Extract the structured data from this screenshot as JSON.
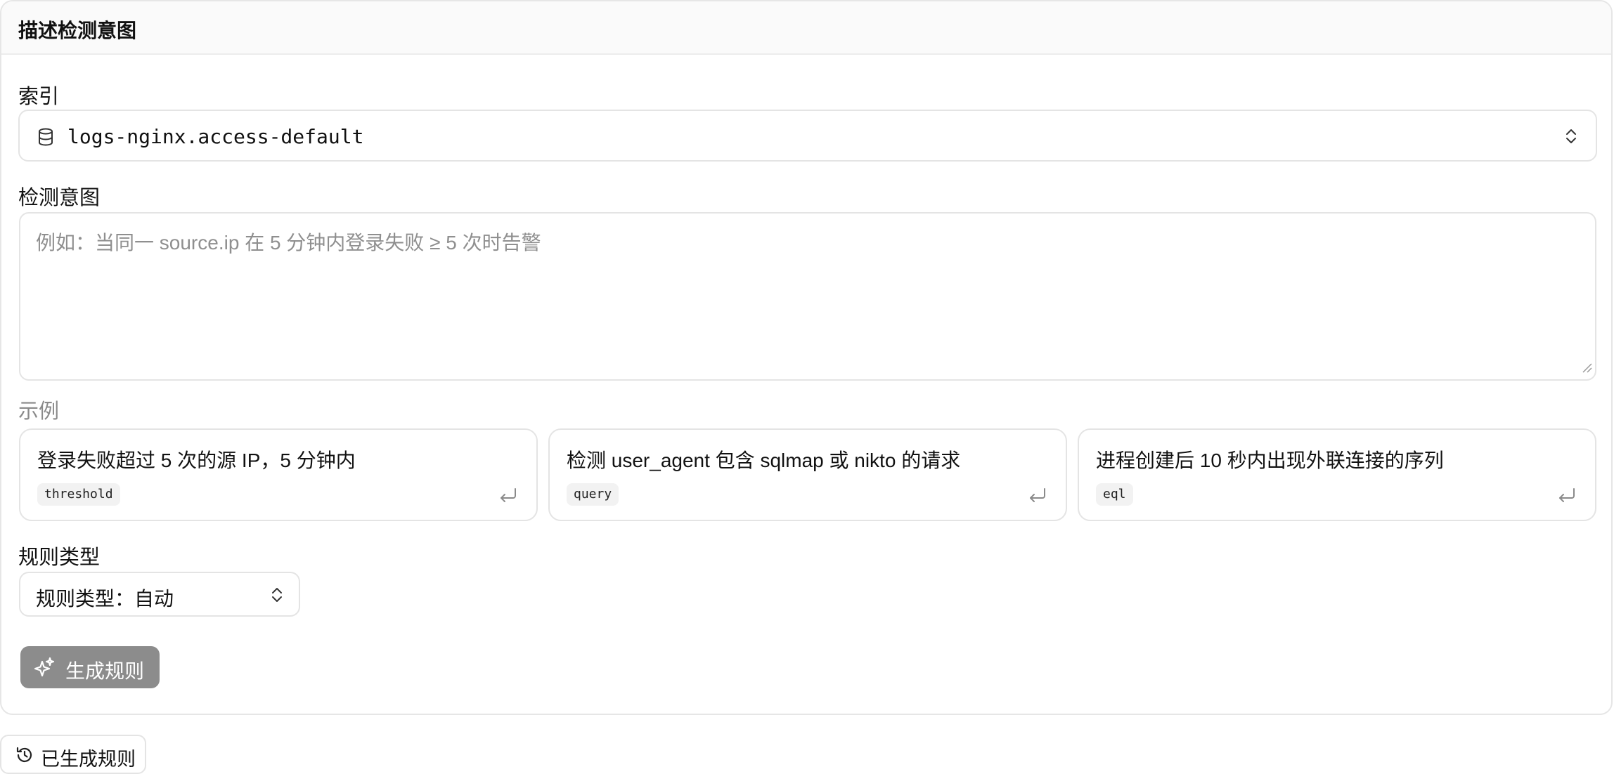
{
  "panel": {
    "title": "描述检测意图"
  },
  "index": {
    "label": "索引",
    "value": "logs-nginx.access-default",
    "icon": "database-icon"
  },
  "intent": {
    "label": "检测意图",
    "placeholder": "例如：当同一 source.ip 在 5 分钟内登录失败 ≥ 5 次时告警"
  },
  "examples": {
    "label": "示例",
    "items": [
      {
        "text": "登录失败超过 5 次的源 IP，5 分钟内",
        "tag": "threshold"
      },
      {
        "text": "检测 user_agent 包含 sqlmap 或 nikto 的请求",
        "tag": "query"
      },
      {
        "text": "进程创建后 10 秒内出现外联连接的序列",
        "tag": "eql"
      }
    ]
  },
  "rule_type": {
    "label": "规则类型",
    "value": "规则类型：自动"
  },
  "generate_button": {
    "label": "生成规则"
  },
  "history_button": {
    "label": "已生成规则"
  },
  "colors": {
    "button_disabled": "#8c8c8c",
    "border": "#e4e4e4",
    "header_bg": "#fafafa"
  }
}
